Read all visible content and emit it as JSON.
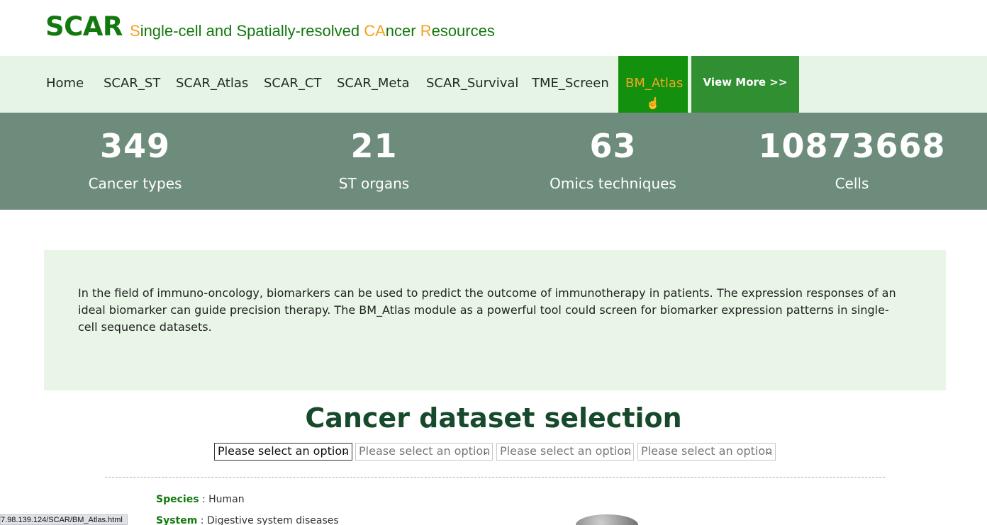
{
  "header": {
    "logo": "SCAR",
    "subtitle_parts": [
      {
        "text": "S",
        "highlight": true
      },
      {
        "text": "ingle-cell and ",
        "highlight": false
      },
      {
        "text": "S",
        "highlight": false
      },
      {
        "text": "patially-resolved ",
        "highlight": false
      },
      {
        "text": "CA",
        "highlight": true
      },
      {
        "text": "ncer ",
        "highlight": false
      },
      {
        "text": "R",
        "highlight": true
      },
      {
        "text": "esources",
        "highlight": false
      }
    ]
  },
  "nav": {
    "items": [
      "Home",
      "SCAR_ST",
      "SCAR_Atlas",
      "SCAR_CT",
      "SCAR_Meta",
      "SCAR_Survival",
      "TME_Screen",
      "BM_Atlas"
    ],
    "active": "BM_Atlas",
    "more": "View More >>"
  },
  "stats": [
    {
      "value": "349",
      "label": "Cancer types"
    },
    {
      "value": "21",
      "label": "ST organs"
    },
    {
      "value": "63",
      "label": "Omics techniques"
    },
    {
      "value": "10873668",
      "label": "Cells"
    }
  ],
  "intro": {
    "text": "In the field of immuno-oncology, biomarkers can be used to predict the outcome of immunotherapy in patients. The expression responses of an ideal biomarker can guide precision therapy. The BM_Atlas module as a powerful tool could screen for biomarker expression patterns in single-cell sequence datasets."
  },
  "selection": {
    "title": "Cancer dataset selection",
    "selects": [
      "Please select an option",
      "Please select an option",
      "Please select an option",
      "Please select an option"
    ]
  },
  "meta": {
    "species_label": "Species",
    "species_value": " : Human",
    "system_label": "System",
    "system_value": " : Digestive system diseases"
  },
  "status_bar": {
    "url": "7.98.139.124/SCAR/BM_Atlas.html"
  },
  "colors": {
    "brand_green": "#12790f",
    "accent_orange": "#f3a21c",
    "nav_bg": "#e6f4e6",
    "stats_bg": "#6e8c7b",
    "intro_bg": "#e9f5e7",
    "title_green": "#174a2c"
  },
  "icons": {
    "select_chevron": "chevron-down-icon",
    "cursor": "hand-pointer-icon"
  }
}
